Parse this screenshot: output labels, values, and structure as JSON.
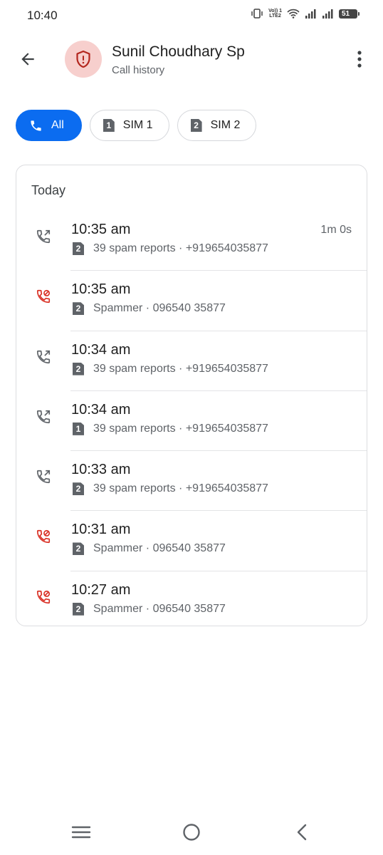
{
  "status_bar": {
    "time": "10:40",
    "volte_top": "Vo)) 1",
    "volte_bottom": "LTE2",
    "battery": "51"
  },
  "header": {
    "contact_name": "Sunil Choudhary Sp",
    "subtitle": "Call history",
    "avatar_icon": "spam-shield-icon",
    "avatar_bg": "#f7cfcd",
    "avatar_fg": "#b3261e"
  },
  "filters": {
    "all": "All",
    "sim1": "SIM 1",
    "sim1_badge": "1",
    "sim2": "SIM 2",
    "sim2_badge": "2",
    "selected_color": "#0b6cf0"
  },
  "history": {
    "section": "Today",
    "calls": [
      {
        "type": "outgoing",
        "time": "10:35 am",
        "sim": "2",
        "detail": "39 spam reports · +919654035877",
        "duration": "1m 0s"
      },
      {
        "type": "blocked",
        "time": "10:35 am",
        "sim": "2",
        "detail": "Spammer · 096540 35877",
        "duration": ""
      },
      {
        "type": "outgoing",
        "time": "10:34 am",
        "sim": "2",
        "detail": "39 spam reports · +919654035877",
        "duration": ""
      },
      {
        "type": "outgoing",
        "time": "10:34 am",
        "sim": "1",
        "detail": "39 spam reports · +919654035877",
        "duration": ""
      },
      {
        "type": "outgoing",
        "time": "10:33 am",
        "sim": "2",
        "detail": "39 spam reports · +919654035877",
        "duration": ""
      },
      {
        "type": "blocked",
        "time": "10:31 am",
        "sim": "2",
        "detail": "Spammer · 096540 35877",
        "duration": ""
      },
      {
        "type": "blocked",
        "time": "10:27 am",
        "sim": "2",
        "detail": "Spammer · 096540 35877",
        "duration": ""
      }
    ]
  },
  "colors": {
    "blocked_red": "#d93025",
    "outgoing_gray": "#5f6368"
  }
}
